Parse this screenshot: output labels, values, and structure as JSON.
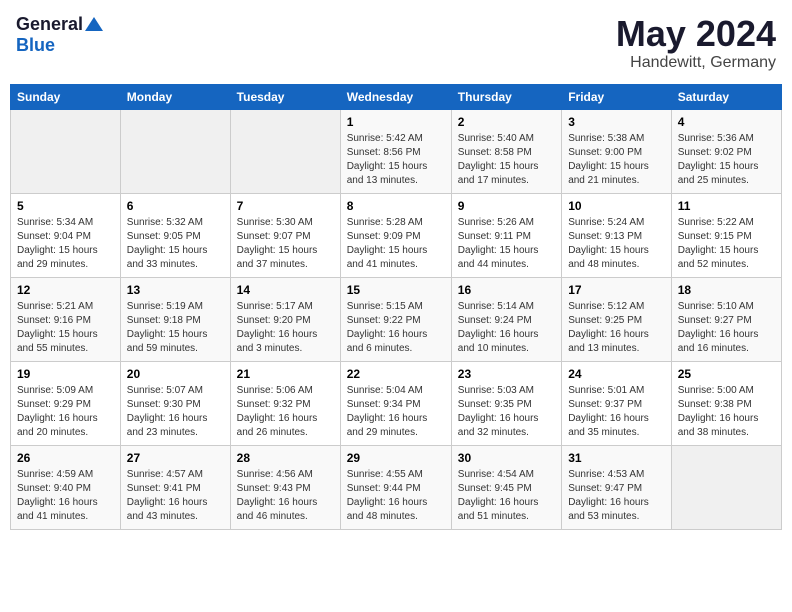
{
  "logo": {
    "general": "General",
    "blue": "Blue"
  },
  "title": {
    "month_year": "May 2024",
    "location": "Handewitt, Germany"
  },
  "headers": [
    "Sunday",
    "Monday",
    "Tuesday",
    "Wednesday",
    "Thursday",
    "Friday",
    "Saturday"
  ],
  "weeks": [
    [
      {
        "day": "",
        "info": ""
      },
      {
        "day": "",
        "info": ""
      },
      {
        "day": "",
        "info": ""
      },
      {
        "day": "1",
        "info": "Sunrise: 5:42 AM\nSunset: 8:56 PM\nDaylight: 15 hours\nand 13 minutes."
      },
      {
        "day": "2",
        "info": "Sunrise: 5:40 AM\nSunset: 8:58 PM\nDaylight: 15 hours\nand 17 minutes."
      },
      {
        "day": "3",
        "info": "Sunrise: 5:38 AM\nSunset: 9:00 PM\nDaylight: 15 hours\nand 21 minutes."
      },
      {
        "day": "4",
        "info": "Sunrise: 5:36 AM\nSunset: 9:02 PM\nDaylight: 15 hours\nand 25 minutes."
      }
    ],
    [
      {
        "day": "5",
        "info": "Sunrise: 5:34 AM\nSunset: 9:04 PM\nDaylight: 15 hours\nand 29 minutes."
      },
      {
        "day": "6",
        "info": "Sunrise: 5:32 AM\nSunset: 9:05 PM\nDaylight: 15 hours\nand 33 minutes."
      },
      {
        "day": "7",
        "info": "Sunrise: 5:30 AM\nSunset: 9:07 PM\nDaylight: 15 hours\nand 37 minutes."
      },
      {
        "day": "8",
        "info": "Sunrise: 5:28 AM\nSunset: 9:09 PM\nDaylight: 15 hours\nand 41 minutes."
      },
      {
        "day": "9",
        "info": "Sunrise: 5:26 AM\nSunset: 9:11 PM\nDaylight: 15 hours\nand 44 minutes."
      },
      {
        "day": "10",
        "info": "Sunrise: 5:24 AM\nSunset: 9:13 PM\nDaylight: 15 hours\nand 48 minutes."
      },
      {
        "day": "11",
        "info": "Sunrise: 5:22 AM\nSunset: 9:15 PM\nDaylight: 15 hours\nand 52 minutes."
      }
    ],
    [
      {
        "day": "12",
        "info": "Sunrise: 5:21 AM\nSunset: 9:16 PM\nDaylight: 15 hours\nand 55 minutes."
      },
      {
        "day": "13",
        "info": "Sunrise: 5:19 AM\nSunset: 9:18 PM\nDaylight: 15 hours\nand 59 minutes."
      },
      {
        "day": "14",
        "info": "Sunrise: 5:17 AM\nSunset: 9:20 PM\nDaylight: 16 hours\nand 3 minutes."
      },
      {
        "day": "15",
        "info": "Sunrise: 5:15 AM\nSunset: 9:22 PM\nDaylight: 16 hours\nand 6 minutes."
      },
      {
        "day": "16",
        "info": "Sunrise: 5:14 AM\nSunset: 9:24 PM\nDaylight: 16 hours\nand 10 minutes."
      },
      {
        "day": "17",
        "info": "Sunrise: 5:12 AM\nSunset: 9:25 PM\nDaylight: 16 hours\nand 13 minutes."
      },
      {
        "day": "18",
        "info": "Sunrise: 5:10 AM\nSunset: 9:27 PM\nDaylight: 16 hours\nand 16 minutes."
      }
    ],
    [
      {
        "day": "19",
        "info": "Sunrise: 5:09 AM\nSunset: 9:29 PM\nDaylight: 16 hours\nand 20 minutes."
      },
      {
        "day": "20",
        "info": "Sunrise: 5:07 AM\nSunset: 9:30 PM\nDaylight: 16 hours\nand 23 minutes."
      },
      {
        "day": "21",
        "info": "Sunrise: 5:06 AM\nSunset: 9:32 PM\nDaylight: 16 hours\nand 26 minutes."
      },
      {
        "day": "22",
        "info": "Sunrise: 5:04 AM\nSunset: 9:34 PM\nDaylight: 16 hours\nand 29 minutes."
      },
      {
        "day": "23",
        "info": "Sunrise: 5:03 AM\nSunset: 9:35 PM\nDaylight: 16 hours\nand 32 minutes."
      },
      {
        "day": "24",
        "info": "Sunrise: 5:01 AM\nSunset: 9:37 PM\nDaylight: 16 hours\nand 35 minutes."
      },
      {
        "day": "25",
        "info": "Sunrise: 5:00 AM\nSunset: 9:38 PM\nDaylight: 16 hours\nand 38 minutes."
      }
    ],
    [
      {
        "day": "26",
        "info": "Sunrise: 4:59 AM\nSunset: 9:40 PM\nDaylight: 16 hours\nand 41 minutes."
      },
      {
        "day": "27",
        "info": "Sunrise: 4:57 AM\nSunset: 9:41 PM\nDaylight: 16 hours\nand 43 minutes."
      },
      {
        "day": "28",
        "info": "Sunrise: 4:56 AM\nSunset: 9:43 PM\nDaylight: 16 hours\nand 46 minutes."
      },
      {
        "day": "29",
        "info": "Sunrise: 4:55 AM\nSunset: 9:44 PM\nDaylight: 16 hours\nand 48 minutes."
      },
      {
        "day": "30",
        "info": "Sunrise: 4:54 AM\nSunset: 9:45 PM\nDaylight: 16 hours\nand 51 minutes."
      },
      {
        "day": "31",
        "info": "Sunrise: 4:53 AM\nSunset: 9:47 PM\nDaylight: 16 hours\nand 53 minutes."
      },
      {
        "day": "",
        "info": ""
      }
    ]
  ]
}
